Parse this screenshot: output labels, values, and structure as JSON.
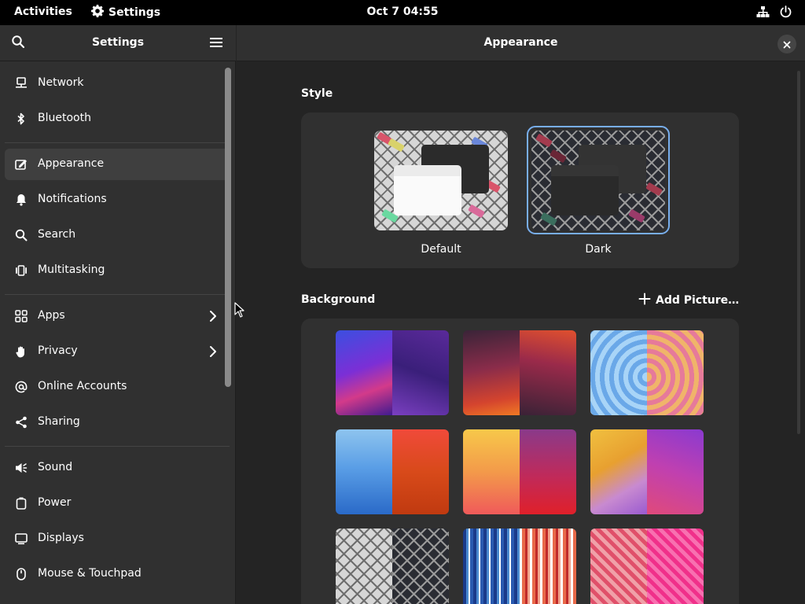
{
  "topbar": {
    "activities": "Activities",
    "app_name": "Settings",
    "clock": "Oct 7  04:55"
  },
  "sidebar": {
    "title": "Settings",
    "items": [
      {
        "label": "Network",
        "icon": "network-icon"
      },
      {
        "label": "Bluetooth",
        "icon": "bluetooth-icon"
      },
      {
        "label": "Appearance",
        "icon": "appearance-icon",
        "selected": true
      },
      {
        "label": "Notifications",
        "icon": "bell-icon"
      },
      {
        "label": "Search",
        "icon": "search-icon"
      },
      {
        "label": "Multitasking",
        "icon": "multitasking-icon"
      },
      {
        "label": "Apps",
        "icon": "apps-icon",
        "has_submenu": true
      },
      {
        "label": "Privacy",
        "icon": "hand-icon",
        "has_submenu": true
      },
      {
        "label": "Online Accounts",
        "icon": "at-icon"
      },
      {
        "label": "Sharing",
        "icon": "share-icon"
      },
      {
        "label": "Sound",
        "icon": "speaker-icon"
      },
      {
        "label": "Power",
        "icon": "power-icon"
      },
      {
        "label": "Displays",
        "icon": "display-icon"
      },
      {
        "label": "Mouse & Touchpad",
        "icon": "mouse-icon"
      }
    ]
  },
  "main": {
    "title": "Appearance",
    "style": {
      "section_title": "Style",
      "options": [
        {
          "label": "Default",
          "selected": false
        },
        {
          "label": "Dark",
          "selected": true
        }
      ]
    },
    "background": {
      "section_title": "Background",
      "add_picture_label": "Add Picture…"
    }
  },
  "colors": {
    "accent": "#78aeed",
    "window_bg": "#242424",
    "sidebar_bg": "#303030",
    "topbar_bg": "#000000"
  }
}
